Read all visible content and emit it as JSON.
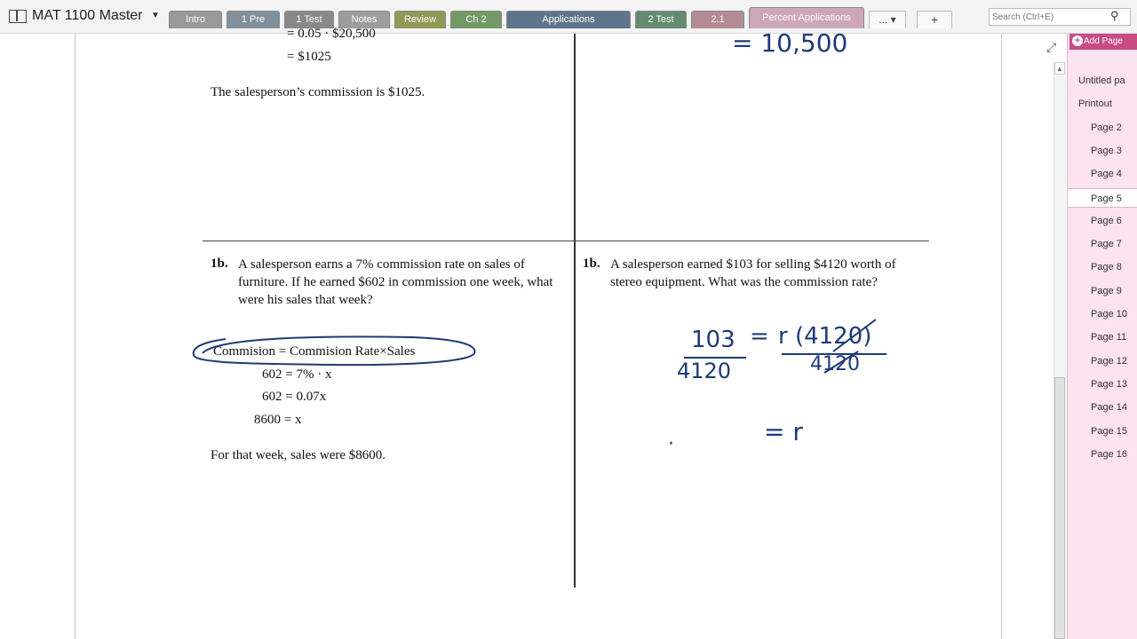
{
  "notebook": {
    "title": "MAT 1100 Master",
    "sections": [
      {
        "label": "Intro",
        "color": "#8a8a8a"
      },
      {
        "label": "1 Pre",
        "color": "#6f7f8c"
      },
      {
        "label": "1 Test",
        "color": "#777777"
      },
      {
        "label": "Notes",
        "color": "#8f8f8f"
      },
      {
        "label": "Review",
        "color": "#7f8a3a"
      },
      {
        "label": "Ch 2",
        "color": "#5d8a4f"
      },
      {
        "label": "Applications",
        "color": "#46607a"
      },
      {
        "label": "2 Test",
        "color": "#4b7a59"
      },
      {
        "label": "2.1",
        "color": "#a77a84"
      },
      {
        "label": "Percent Applications",
        "color": "#c79aae"
      }
    ],
    "more_label": "...",
    "add_tab_label": "+"
  },
  "search": {
    "placeholder": "Search (Ctrl+E)"
  },
  "icons": {
    "search": "magnifier-icon",
    "expand": "expand-icon",
    "add_page": "plus-circle-icon"
  },
  "worksheet": {
    "top_left": {
      "line1": "= 0.05 · $20,500",
      "line2": "= $1025",
      "conclusion": "The salesperson’s commission is $1025."
    },
    "left": {
      "number": "1b.",
      "problem": "A salesperson earns a 7% commission rate on sales of furniture.  If he earned $602 in commission one week, what were his sales that week?",
      "formula": "Commision = Commision Rate×Sales",
      "steps": [
        "602 = 7% · x",
        "602 = 0.07x",
        "8600 = x"
      ],
      "conclusion": "For that week, sales were $8600."
    },
    "right": {
      "number": "1b.",
      "problem": "A salesperson earned $103 for selling $4120 worth of stereo equipment. What was the commission rate?"
    }
  },
  "handwriting": {
    "top_right": "=  10,500",
    "lhs_num": "103",
    "lhs_den": "4120",
    "eq": "=",
    "rhs_num": "r (4120)",
    "rhs_den": "4120",
    "result": "=  r",
    "dot": "·"
  },
  "pages": {
    "add_label": "Add Page",
    "items": [
      "Untitled pa",
      "Printout",
      "Page 2",
      "Page 3",
      "Page 4",
      "Page 5",
      "Page 6",
      "Page 7",
      "Page 8",
      "Page 9",
      "Page 10",
      "Page 11",
      "Page 12",
      "Page 13",
      "Page 14",
      "Page 15",
      "Page 16"
    ],
    "active": "Page 5"
  }
}
